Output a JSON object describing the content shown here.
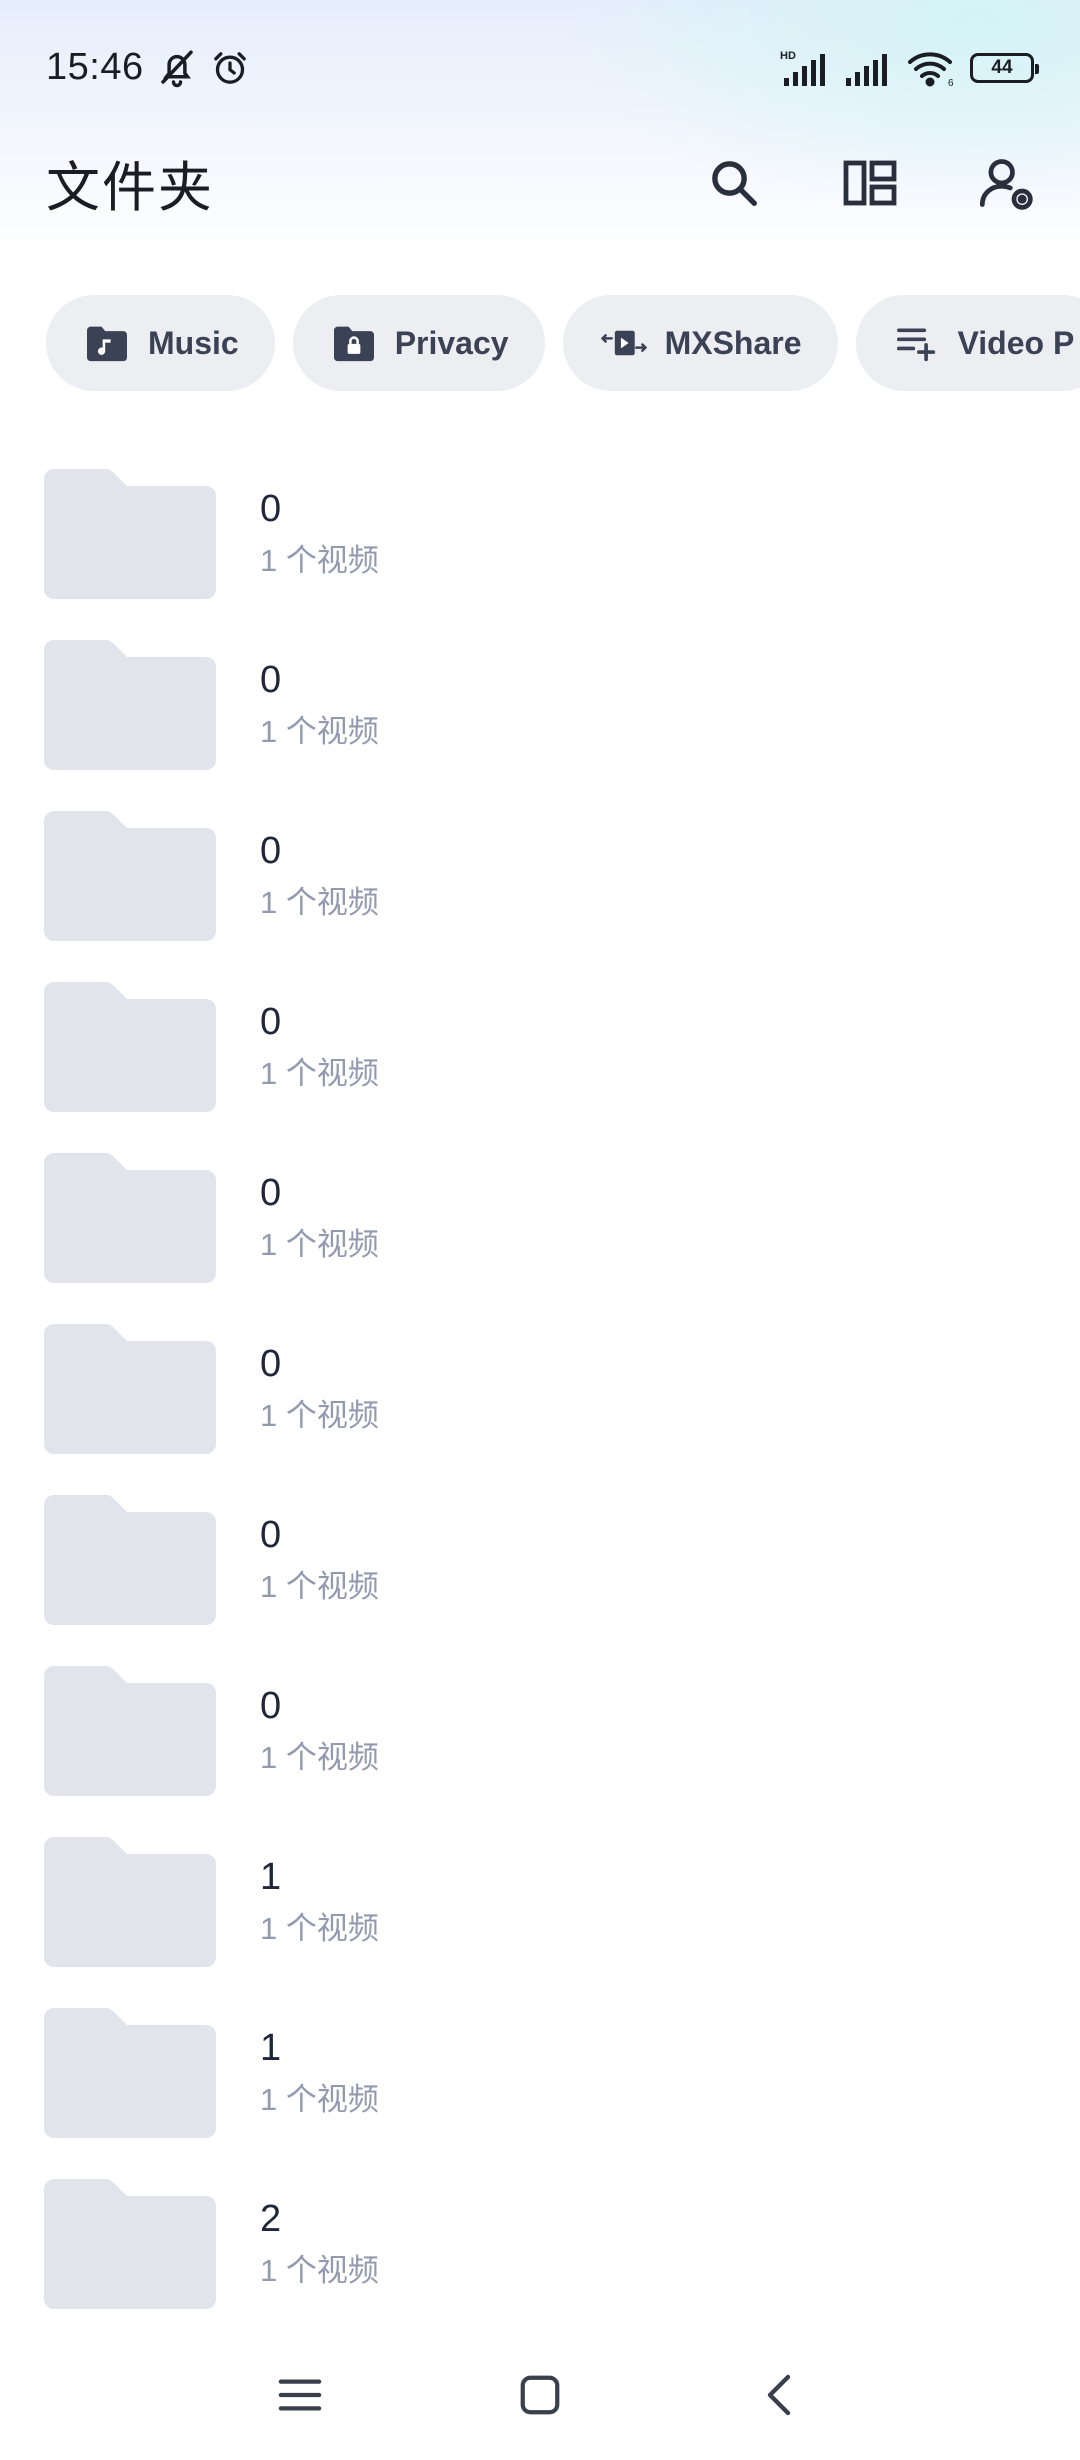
{
  "status_bar": {
    "time": "15:46",
    "battery": "44",
    "icons": [
      "bell-off-icon",
      "alarm-icon",
      "hd-signal-icon",
      "signal-icon",
      "wifi-icon",
      "battery-icon"
    ]
  },
  "app_bar": {
    "title": "文件夹",
    "actions": [
      "search-icon",
      "layout-icon",
      "account-settings-icon"
    ]
  },
  "chips": [
    {
      "label": "Music",
      "icon": "music-folder-icon"
    },
    {
      "label": "Privacy",
      "icon": "lock-folder-icon"
    },
    {
      "label": "MXShare",
      "icon": "share-transfer-icon"
    },
    {
      "label": "Video P",
      "icon": "playlist-add-icon"
    }
  ],
  "folders": [
    {
      "name": "0",
      "count": "1 个视频"
    },
    {
      "name": "0",
      "count": "1 个视频"
    },
    {
      "name": "0",
      "count": "1 个视频"
    },
    {
      "name": "0",
      "count": "1 个视频"
    },
    {
      "name": "0",
      "count": "1 个视频"
    },
    {
      "name": "0",
      "count": "1 个视频"
    },
    {
      "name": "0",
      "count": "1 个视频"
    },
    {
      "name": "0",
      "count": "1 个视频"
    },
    {
      "name": "1",
      "count": "1 个视频"
    },
    {
      "name": "1",
      "count": "1 个视频"
    },
    {
      "name": "2",
      "count": "1 个视频"
    }
  ],
  "nav_bar": [
    "menu-icon",
    "home-icon",
    "back-icon"
  ],
  "colors": {
    "chip_bg": "#eceef2",
    "chip_text": "#3c4255",
    "folder_fill": "#e1e4ea",
    "subtitle": "#939aaf"
  }
}
